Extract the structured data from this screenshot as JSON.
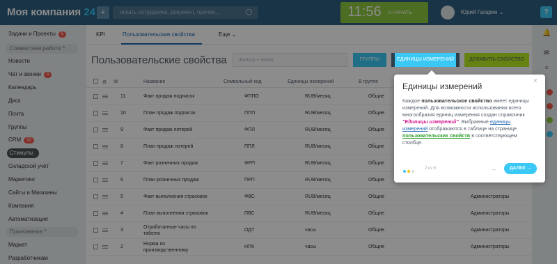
{
  "header": {
    "logo_text": "Моя компания",
    "logo_num": "24",
    "plus_icon": "+",
    "search_placeholder": "искать сотрудника, документ, прочее...",
    "time": "11:56",
    "start_label": "⊙ НАЧАТЬ",
    "user_name": "Юрий Гагарин ⌄",
    "help_label": "?"
  },
  "sidebar": {
    "items": [
      {
        "label": "Задачи и Проекты",
        "badge": "5"
      },
      {
        "label": "Совместная работа ^"
      },
      {
        "label": "Новости"
      },
      {
        "label": "Чат и звонки",
        "badge": "3"
      },
      {
        "label": "Календарь"
      },
      {
        "label": "Диск"
      },
      {
        "label": "Почта"
      },
      {
        "label": "Группы"
      },
      {
        "label": "CRM",
        "badge": "12"
      },
      {
        "label": "Стимулы"
      },
      {
        "label": "Складской учёт"
      },
      {
        "label": "Маркетинг"
      },
      {
        "label": "Сайты и Магазины"
      },
      {
        "label": "Компания"
      },
      {
        "label": "Автоматизация"
      },
      {
        "label": "Приложения ^"
      },
      {
        "label": "Маркет"
      },
      {
        "label": "Разработчикам"
      }
    ]
  },
  "tabs": [
    "KPI",
    "Пользовательские свойства",
    "Еще ⌄"
  ],
  "page_title": "Пользовательские свойства",
  "star_icon": "☆",
  "filter_placeholder": "Фильтр + поиск",
  "buttons": {
    "groups": "ГРУППЫ",
    "units": "ЕДИНИЦЫ ИЗМЕРЕНИЙ",
    "add": "ДОБАВИТЬ СВОЙСТВО"
  },
  "table": {
    "headers": [
      "Id",
      "Название",
      "Символьный код",
      "Единицы измерений",
      "В группе"
    ],
    "rows": [
      {
        "id": "11",
        "name": "Факт продаж подписок",
        "code": "ФППО",
        "unit": "RUB/месяц",
        "group": "Общие",
        "extra": ""
      },
      {
        "id": "10",
        "name": "План продаж подписок",
        "code": "ППП",
        "unit": "RUB/месяц",
        "group": "Общие",
        "extra": ""
      },
      {
        "id": "9",
        "name": "Факт продаж лотерей",
        "code": "ФПЛ",
        "unit": "RUB/месяц",
        "group": "Общие",
        "extra": ""
      },
      {
        "id": "8",
        "name": "План продаж лотерей",
        "code": "ППЛ",
        "unit": "RUB/месяц",
        "group": "Общие",
        "extra": ""
      },
      {
        "id": "7",
        "name": "Факт розничных продаж",
        "code": "ФРП",
        "unit": "RUB/месяц",
        "group": "Общие",
        "extra": ""
      },
      {
        "id": "6",
        "name": "План розничных продаж",
        "code": "ПРП",
        "unit": "RUB/месяц",
        "group": "Общие",
        "extra": "Администраторы"
      },
      {
        "id": "5",
        "name": "Факт выполнения страховок",
        "code": "ФВС",
        "unit": "RUB/месяц",
        "group": "Общие",
        "extra": "Администраторы"
      },
      {
        "id": "4",
        "name": "План выполнения страховок",
        "code": "ПВС",
        "unit": "RUB/месяц",
        "group": "Общие",
        "extra": "Администраторы"
      },
      {
        "id": "3",
        "name": "Отработанные часы по\nтабелю",
        "code": "ОДТ",
        "unit": "часы",
        "group": "Общие",
        "extra": "Администраторы"
      },
      {
        "id": "2",
        "name": "Норма по\nпроизводственному",
        "code": "НПК",
        "unit": "часы",
        "group": "Общие",
        "extra": "Администраторы"
      }
    ]
  },
  "popup": {
    "title": "Единицы измерений",
    "close_icon": "×",
    "text_1": "Каждое ",
    "text_bold": "пользовательское свойство",
    "text_2": " имеет единицы измерений. Для возможности использования всего многообразия единиц измерения создан справочник ",
    "text_pink": "\"Единицы измерений\"",
    "text_3": ". Выбранные ",
    "text_link": "единицы измерений",
    "text_4": " отображаются в таблице на странице ",
    "text_green": "пользовательских свойств",
    "text_5": " в соответствующем столбце.",
    "counter": "2 из 5",
    "back_icon": "←",
    "next_label": "ДАЛЕЕ →"
  },
  "colors": {
    "header": "#2f5f80",
    "accent": "#3bc8f5",
    "clock": "#8cc63e",
    "add_button": "#bbed21",
    "badge": "#f15a4b"
  }
}
